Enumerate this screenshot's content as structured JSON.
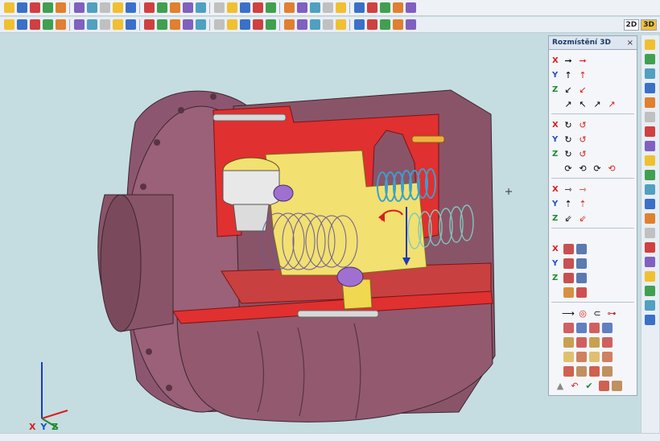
{
  "toolbar_top": {
    "icons": [
      "new-file-icon",
      "open-file-icon",
      "save-icon",
      "save-all-icon",
      "copy-icon",
      "paste-icon",
      "undo-icon",
      "redo-icon",
      "box-primitive-icon",
      "cylinder-primitive-icon",
      "cone-primitive-icon",
      "sphere-primitive-icon",
      "torus-primitive-icon",
      "extrude-icon",
      "revolve-icon",
      "fillet-icon",
      "chamfer-icon",
      "hole-icon",
      "boolean-union-icon",
      "boolean-subtract-icon",
      "boolean-intersect-icon",
      "shell-icon",
      "loft-icon",
      "sweep-icon",
      "zoom-fit-icon",
      "zoom-in-icon",
      "zoom-out-icon",
      "zoom-window-icon",
      "zoom-all-icon",
      "pan-icon"
    ]
  },
  "toolbar_second": {
    "icons": [
      "cut-icon",
      "pointer-icon",
      "select-icon",
      "move-icon",
      "rotate-icon",
      "measure-icon",
      "section-icon",
      "view-top-icon",
      "view-front-icon",
      "view-side-icon",
      "view-iso-icon",
      "shade-icon",
      "wireframe-icon",
      "hidden-line-icon",
      "material-icon",
      "light-icon",
      "render-icon",
      "layer-icon",
      "color-icon",
      "texture-icon",
      "transparency-icon",
      "camera-icon",
      "snap-icon",
      "grid-icon",
      "constraint-icon",
      "assembly-icon",
      "part-icon",
      "drawing-icon",
      "dimension-icon",
      "annotation-icon"
    ],
    "mode_2d": "2D",
    "mode_3d": "3D"
  },
  "panel": {
    "title": "Rozmístění 3D",
    "close": "×",
    "axis_x": "X",
    "axis_y": "Y",
    "axis_z": "Z"
  },
  "viewport": {
    "axis_label": "X Y Z"
  },
  "colors": {
    "housing": "#8a5468",
    "section_cut": "#e03030",
    "inner_parts": "#f2e070",
    "spring_blue": "#3aa0d0",
    "spring_cyan": "#7cc8c0",
    "background": "#c5dde0"
  }
}
